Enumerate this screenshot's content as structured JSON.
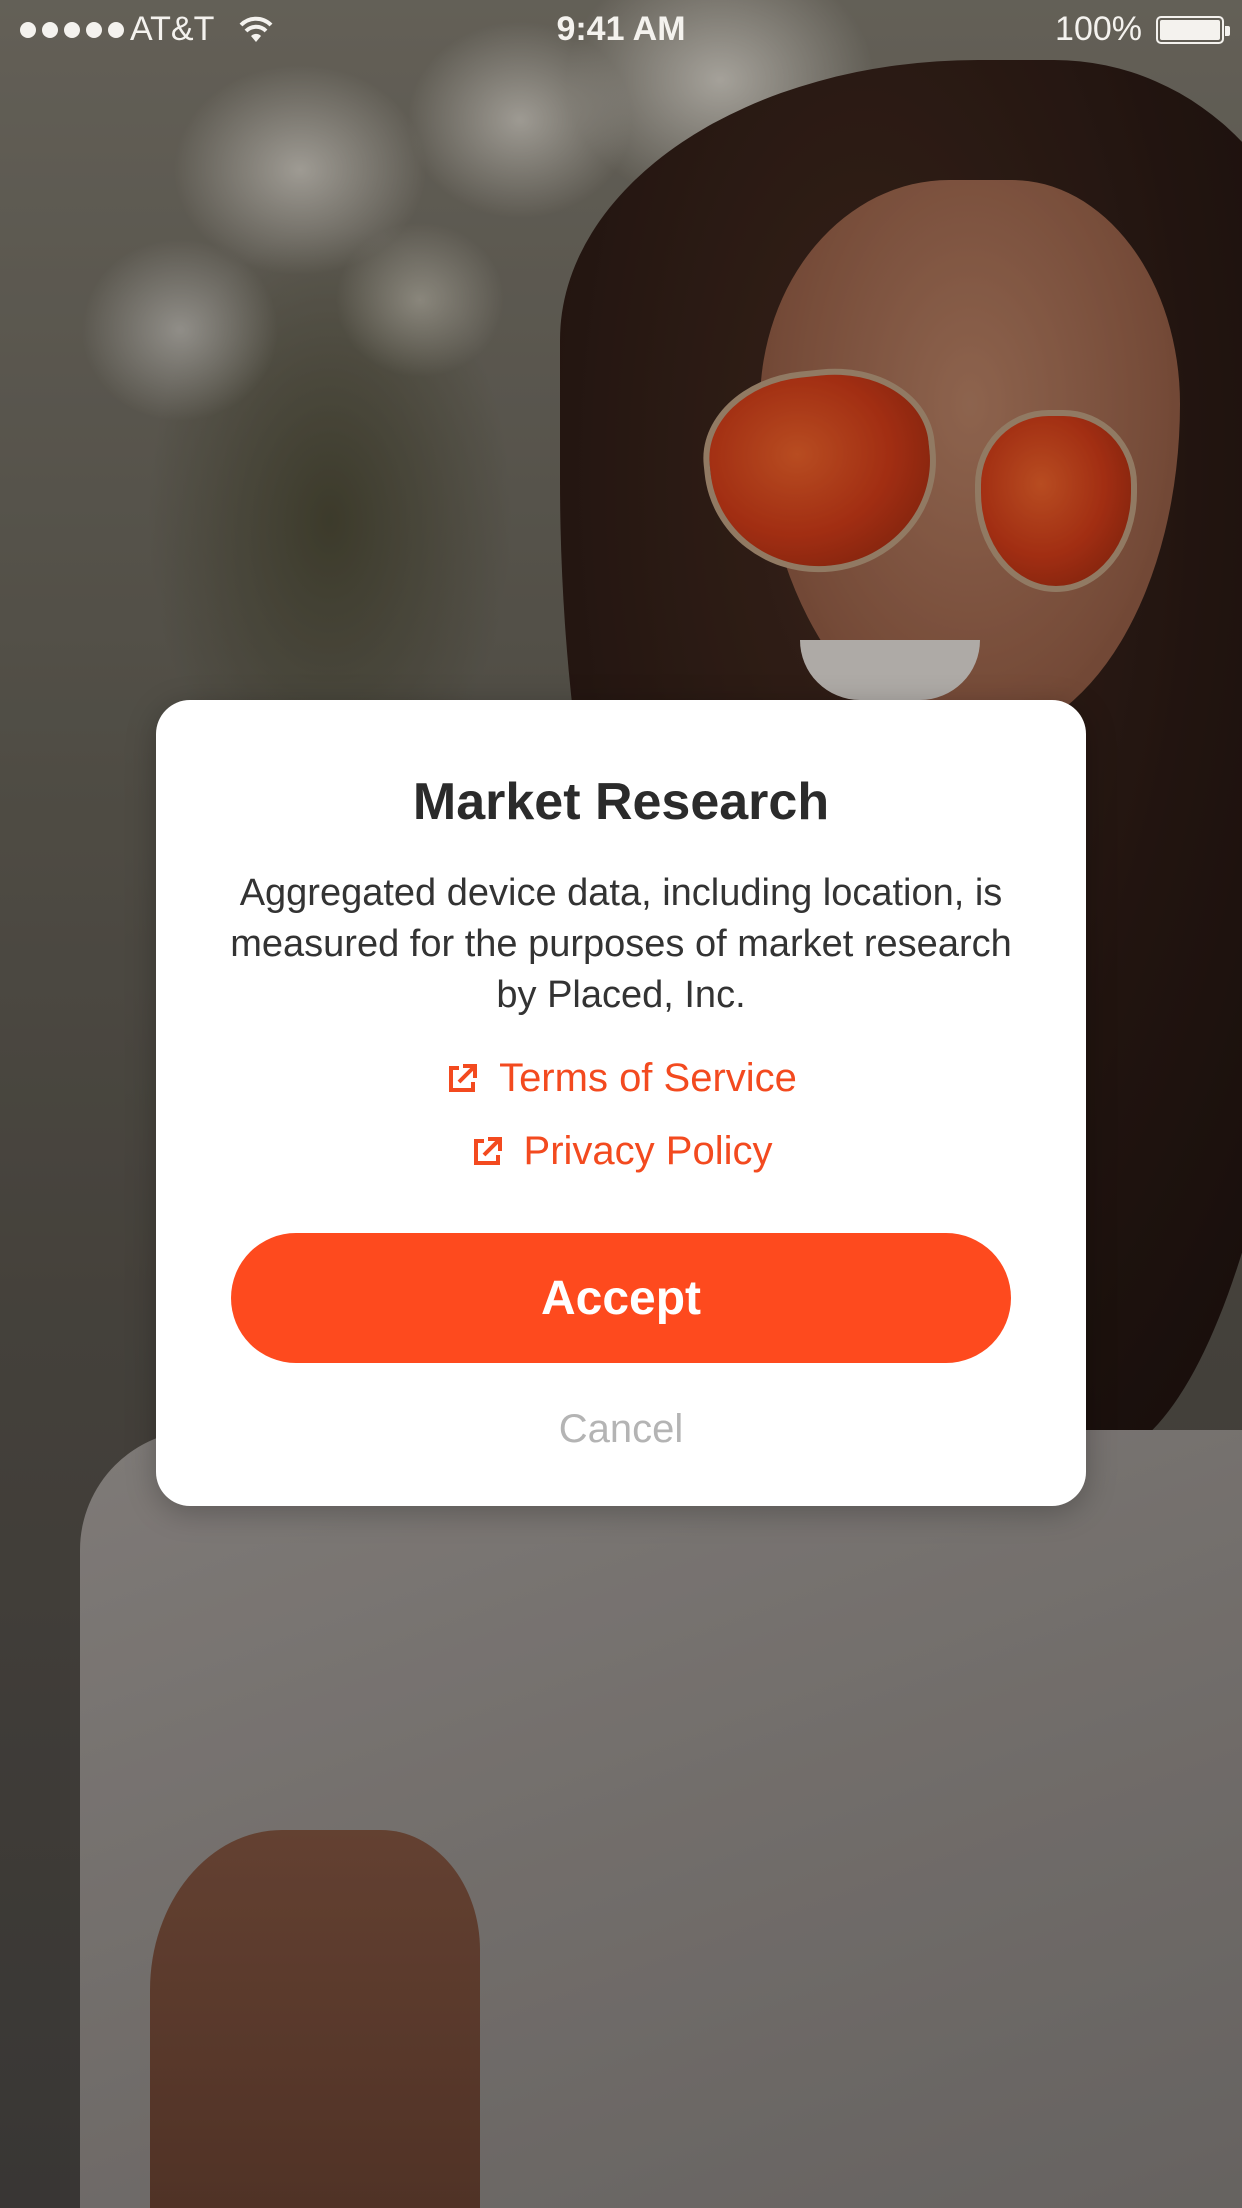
{
  "status_bar": {
    "carrier": "AT&T",
    "time": "9:41 AM",
    "battery": "100%",
    "signal_icon": "signal-dots-icon",
    "wifi_icon": "wifi-icon",
    "battery_icon": "battery-icon"
  },
  "background": {
    "description_icon": "background-photo"
  },
  "modal": {
    "title": "Market Research",
    "body": "Aggregated device data, including location, is measured for the purposes of market research by Placed, Inc.",
    "links": {
      "terms": "Terms of Service",
      "privacy": "Privacy Policy",
      "icon": "external-link-icon"
    },
    "accept_label": "Accept",
    "cancel_label": "Cancel"
  },
  "colors": {
    "accent": "#fe4a1e",
    "link": "#f34a1f",
    "cancel": "#b4b4b4"
  }
}
